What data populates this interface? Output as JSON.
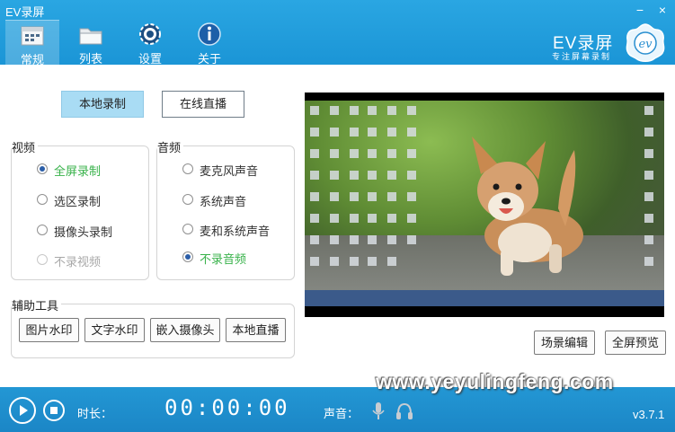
{
  "app": {
    "title": "EV录屏"
  },
  "window": {
    "minimize": "−",
    "close": "×"
  },
  "nav": [
    {
      "label": "常规",
      "icon": "calendar-icon"
    },
    {
      "label": "列表",
      "icon": "folder-icon"
    },
    {
      "label": "设置",
      "icon": "gear-icon"
    },
    {
      "label": "关于",
      "icon": "info-icon"
    }
  ],
  "logo": {
    "text": "EV录屏",
    "subtitle": "专注屏幕录制",
    "badge": "ev"
  },
  "modes": {
    "local": "本地录制",
    "live": "在线直播"
  },
  "video": {
    "title": "视频",
    "options": [
      "全屏录制",
      "选区录制",
      "摄像头录制",
      "不录视频"
    ],
    "selected": "全屏录制"
  },
  "audio": {
    "title": "音频",
    "options": [
      "麦克风声音",
      "系统声音",
      "麦和系统声音",
      "不录音频"
    ],
    "selected": "不录音频"
  },
  "tools": {
    "title": "辅助工具",
    "buttons": [
      "图片水印",
      "文字水印",
      "嵌入摄像头",
      "本地直播"
    ]
  },
  "preview_buttons": {
    "scene_edit": "场景编辑",
    "fullscreen_preview": "全屏预览"
  },
  "footer": {
    "duration_label": "时长：",
    "timer": "00:00:00",
    "sound_label": "声音：",
    "version": "v3.7.1"
  },
  "watermark": "www.yeyulingfeng.com",
  "colors": {
    "header": "#1b95d6",
    "accent_green": "#38b24a",
    "active_mode": "#a9dcf4"
  }
}
